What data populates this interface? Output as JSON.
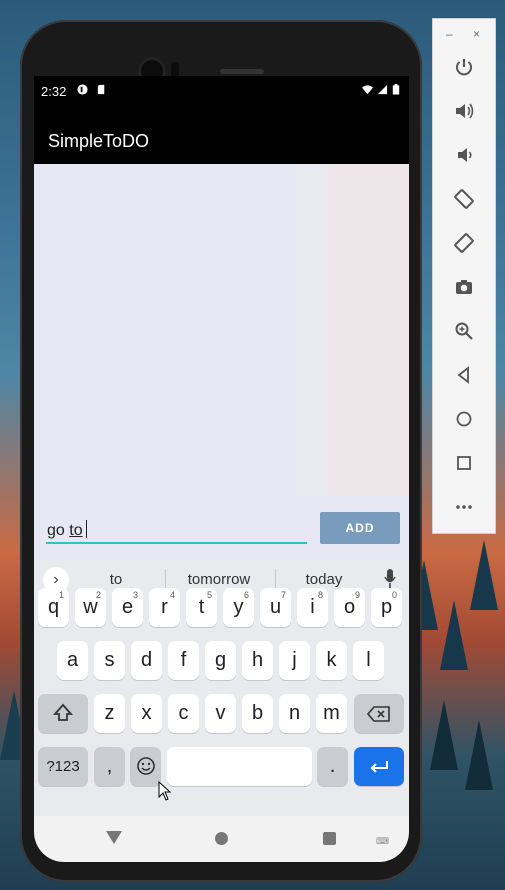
{
  "status_bar": {
    "time": "2:32"
  },
  "app": {
    "title": "SimpleToDO"
  },
  "input": {
    "typed_prefix": "go ",
    "composing_word": "to"
  },
  "add_button": {
    "label": "ADD"
  },
  "keyboard": {
    "suggestions": [
      "to",
      "tomorrow",
      "today"
    ],
    "row1": [
      {
        "k": "q",
        "n": "1"
      },
      {
        "k": "w",
        "n": "2"
      },
      {
        "k": "e",
        "n": "3"
      },
      {
        "k": "r",
        "n": "4"
      },
      {
        "k": "t",
        "n": "5"
      },
      {
        "k": "y",
        "n": "6"
      },
      {
        "k": "u",
        "n": "7"
      },
      {
        "k": "i",
        "n": "8"
      },
      {
        "k": "o",
        "n": "9"
      },
      {
        "k": "p",
        "n": "0"
      }
    ],
    "row2": [
      "a",
      "s",
      "d",
      "f",
      "g",
      "h",
      "j",
      "k",
      "l"
    ],
    "row3": [
      "z",
      "x",
      "c",
      "v",
      "b",
      "n",
      "m"
    ],
    "symbols_label": "?123",
    "comma": ",",
    "period": "."
  },
  "emulator_toolbar": {
    "minimize": "–",
    "close": "×",
    "tools": [
      "power-icon",
      "volume-up-icon",
      "volume-down-icon",
      "rotate-left-icon",
      "rotate-right-icon",
      "camera-icon",
      "zoom-icon",
      "back-icon",
      "home-icon",
      "overview-icon",
      "more-icon"
    ]
  },
  "colors": {
    "accent": "#26c6c6",
    "button": "#7a9cbc",
    "enter": "#1a73e8"
  }
}
